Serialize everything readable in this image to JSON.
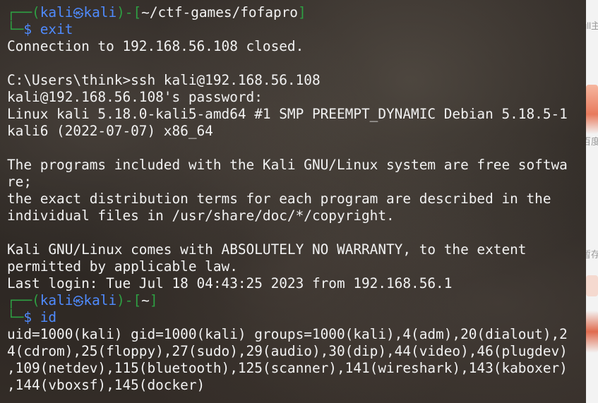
{
  "terminal": {
    "lines": [
      {
        "type": "prompt-top",
        "user": "kali",
        "host": "kali",
        "dir": "~/ctf-games/fofapro"
      },
      {
        "type": "prompt-cmd",
        "cmd": "exit"
      },
      {
        "type": "text",
        "text": "Connection to 192.168.56.108 closed."
      },
      {
        "type": "text",
        "text": ""
      },
      {
        "type": "text",
        "text": "C:\\Users\\think>ssh kali@192.168.56.108"
      },
      {
        "type": "text",
        "text": "kali@192.168.56.108's password:"
      },
      {
        "type": "text",
        "text": "Linux kali 5.18.0-kali5-amd64 #1 SMP PREEMPT_DYNAMIC Debian 5.18.5-1"
      },
      {
        "type": "text",
        "text": "kali6 (2022-07-07) x86_64"
      },
      {
        "type": "text",
        "text": ""
      },
      {
        "type": "text",
        "text": "The programs included with the Kali GNU/Linux system are free softwa"
      },
      {
        "type": "text",
        "text": "re;"
      },
      {
        "type": "text",
        "text": "the exact distribution terms for each program are described in the"
      },
      {
        "type": "text",
        "text": "individual files in /usr/share/doc/*/copyright."
      },
      {
        "type": "text",
        "text": ""
      },
      {
        "type": "text",
        "text": "Kali GNU/Linux comes with ABSOLUTELY NO WARRANTY, to the extent"
      },
      {
        "type": "text",
        "text": "permitted by applicable law."
      },
      {
        "type": "text",
        "text": "Last login: Tue Jul 18 04:43:25 2023 from 192.168.56.1"
      },
      {
        "type": "prompt-top",
        "user": "kali",
        "host": "kali",
        "dir": "~"
      },
      {
        "type": "prompt-cmd",
        "cmd": "id"
      },
      {
        "type": "text",
        "text": "uid=1000(kali) gid=1000(kali) groups=1000(kali),4(adm),20(dialout),2"
      },
      {
        "type": "text",
        "text": "4(cdrom),25(floppy),27(sudo),29(audio),30(dip),44(video),46(plugdev)"
      },
      {
        "type": "text",
        "text": ",109(netdev),115(bluetooth),125(scanner),141(wireshark),143(kaboxer)"
      },
      {
        "type": "text",
        "text": ",144(vboxsf),145(docker)"
      }
    ]
  },
  "right_panel": {
    "texts": [
      {
        "text": "ull主"
      },
      {
        "text": "百度网"
      },
      {
        "text": "暂存"
      }
    ]
  },
  "colors": {
    "prompt_green": "#2ea043",
    "prompt_blue": "#4f8bff",
    "text": "#f2f2f2"
  }
}
